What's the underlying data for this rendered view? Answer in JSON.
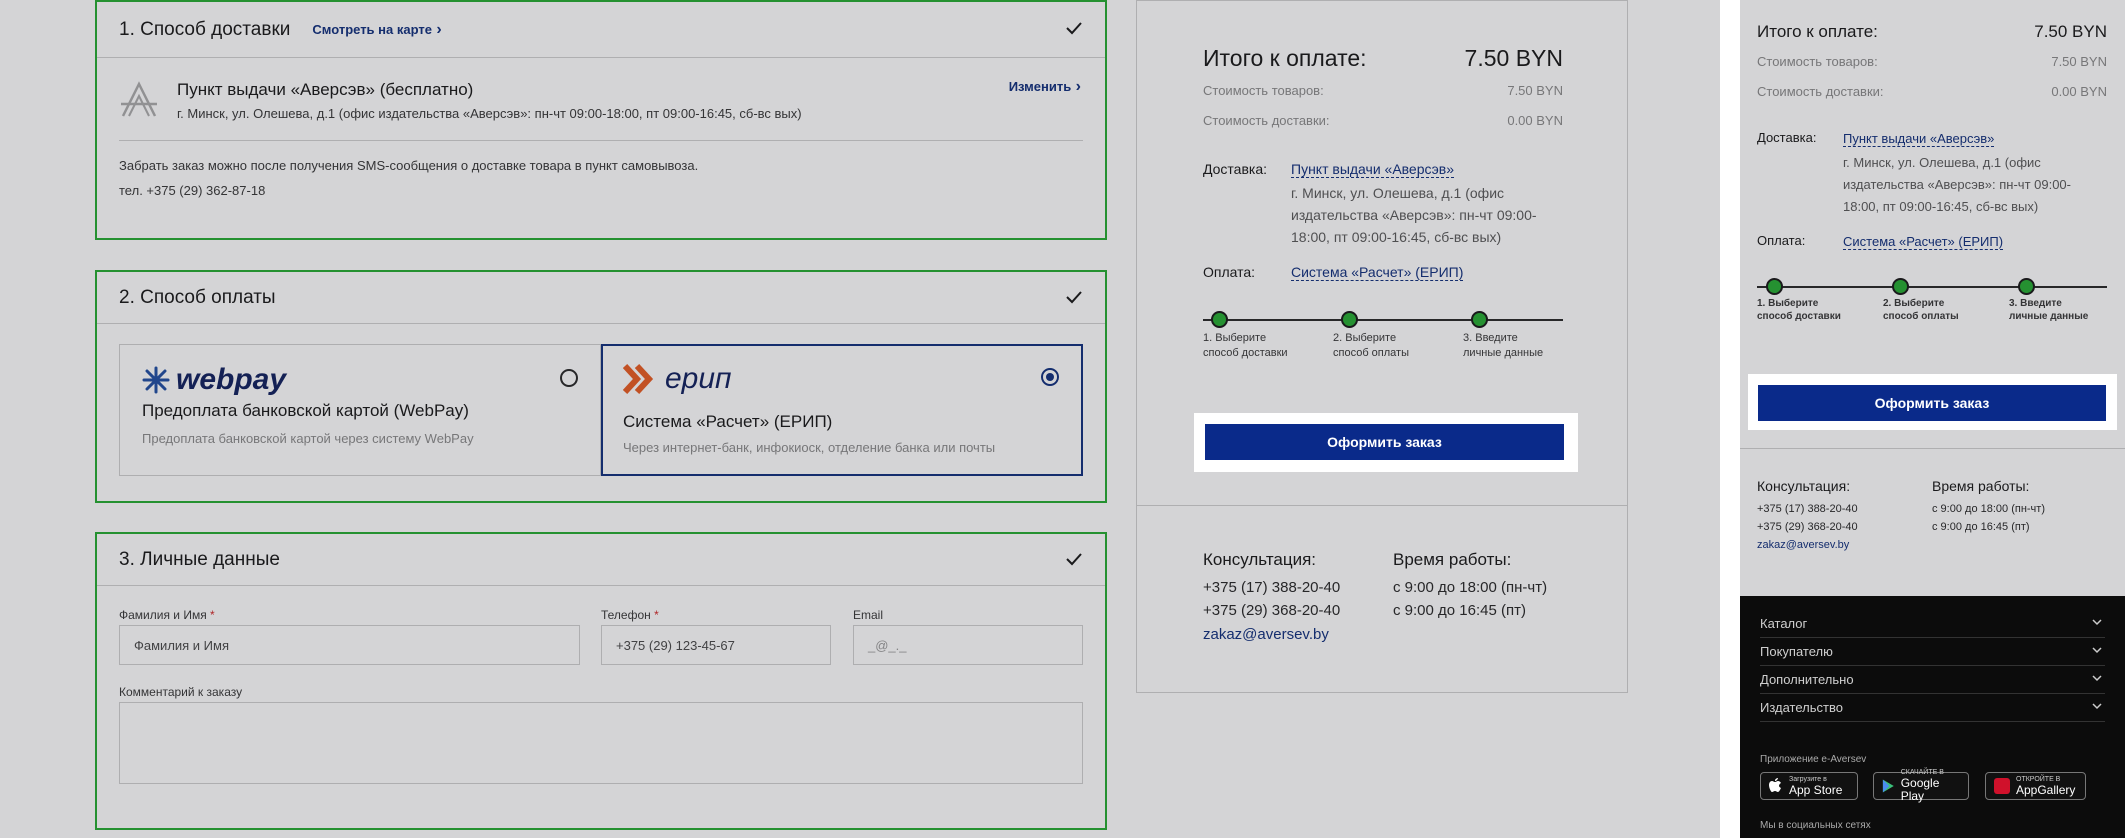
{
  "delivery": {
    "title": "1. Способ доставки",
    "map_link": "Смотреть на карте",
    "pickup_title": "Пункт выдачи «Аверсэв» (бесплатно)",
    "pickup_address": "г. Минск, ул. Олешева, д.1 (офис издательства «Аверсэв»: пн-чт 09:00-18:00, пт 09:00-16:45, сб-вс вых)",
    "change_link": "Изменить",
    "note": "Забрать заказ можно после получения SMS-сообщения о доставке товара в пункт самовывоза.",
    "phone": "тел. +375 (29) 362-87-18"
  },
  "payment": {
    "title": "2. Способ оплаты",
    "webpay_logo": "webpay",
    "webpay_name": "Предоплата банковской картой (WebPay)",
    "webpay_desc": "Предоплата банковской картой через систему WebPay",
    "erip_logo": "ерип",
    "erip_name": "Система «Расчет» (ЕРИП)",
    "erip_desc": "Через интернет-банк, инфокиоск, отделение банка или почты",
    "selected": "erip"
  },
  "personal": {
    "title": "3. Личные данные",
    "name_label": "Фамилия и Имя",
    "name_placeholder": "Фамилия и Имя",
    "phone_label": "Телефон",
    "phone_placeholder": "+375 (29) 123-45-67",
    "email_label": "Email",
    "email_placeholder": "_@_._",
    "comment_label": "Комментарий к заказу",
    "required_mark": "*"
  },
  "summary": {
    "total_label": "Итого к оплате:",
    "total_value": "7.50 BYN",
    "goods_label": "Стоимость товаров:",
    "goods_value": "7.50 BYN",
    "delivery_label": "Стоимость доставки:",
    "delivery_value": "0.00 BYN",
    "delivery_key": "Доставка:",
    "delivery_link": "Пункт выдачи «Аверсэв»",
    "delivery_addr": "г. Минск, ул. Олешева, д.1 (офис издательства «Аверсэв»: пн-чт 09:00-18:00, пт 09:00-16:45, сб-вс вых)",
    "payment_key": "Оплата:",
    "payment_link": "Система «Расчет» (ЕРИП)",
    "steps": [
      {
        "l1": "1. Выберите",
        "l2": "способ доставки"
      },
      {
        "l1": "2. Выберите",
        "l2": "способ оплаты"
      },
      {
        "l1": "3. Введите",
        "l2": "личные данные"
      }
    ],
    "order_button": "Оформить заказ",
    "consult_title": "Консультация:",
    "phone1": "+375 (17) 388-20-40",
    "phone2": "+375 (29) 368-20-40",
    "email": "zakaz@aversev.by",
    "hours_title": "Время работы:",
    "hours1": "с 9:00 до 18:00 (пн-чт)",
    "hours2": "с 9:00 до 16:45 (пт)"
  },
  "footer": {
    "items": [
      "Каталог",
      "Покупателю",
      "Дополнительно",
      "Издательство"
    ],
    "app_label": "Приложение e-Aversev",
    "app_store_small": "Загрузите в",
    "app_store": "App Store",
    "google_small": "СКАЧАЙТЕ В",
    "google": "Google Play",
    "huawei_small": "ОТКРОЙТЕ В",
    "huawei": "AppGallery",
    "social": "Мы в социальных сетях"
  },
  "colors": {
    "accent": "#0a2a8a",
    "success": "#1faa2c",
    "footer_bg": "#0c0c0c"
  }
}
